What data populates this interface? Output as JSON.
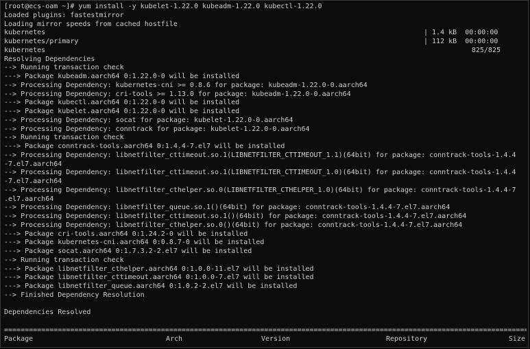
{
  "terminal": {
    "prompt": "[root@ecs-oam ~]# yum install -y kubelet-1.22.0 kubeadm-1.22.0 kubectl-1.22.0",
    "loaded_plugins": "Loaded plugins: fastestmirror",
    "mirror_speeds": "Loading mirror speeds from cached hostfile",
    "repos": [
      {
        "name": "kubernetes",
        "size": "| 1.4 kB  00:00:00",
        "done": ""
      },
      {
        "name": "kubernetes/primary",
        "size": "| 112 kB  00:00:00",
        "done": ""
      },
      {
        "name": "kubernetes",
        "size": "",
        "done": "825/825"
      }
    ],
    "lines": [
      "Resolving Dependencies",
      "--> Running transaction check",
      "---> Package kubeadm.aarch64 0:1.22.0-0 will be installed",
      "--> Processing Dependency: kubernetes-cni >= 0.8.6 for package: kubeadm-1.22.0-0.aarch64",
      "--> Processing Dependency: cri-tools >= 1.13.0 for package: kubeadm-1.22.0-0.aarch64",
      "---> Package kubectl.aarch64 0:1.22.0-0 will be installed",
      "---> Package kubelet.aarch64 0:1.22.0-0 will be installed",
      "--> Processing Dependency: socat for package: kubelet-1.22.0-0.aarch64",
      "--> Processing Dependency: conntrack for package: kubelet-1.22.0-0.aarch64",
      "--> Running transaction check",
      "---> Package conntrack-tools.aarch64 0:1.4.4-7.el7 will be installed",
      "--> Processing Dependency: libnetfilter_cttimeout.so.1(LIBNETFILTER_CTTIMEOUT_1.1)(64bit) for package: conntrack-tools-1.4.4",
      "-7.el7.aarch64",
      "--> Processing Dependency: libnetfilter_cttimeout.so.1(LIBNETFILTER_CTTIMEOUT_1.0)(64bit) for package: conntrack-tools-1.4.4",
      "-7.el7.aarch64",
      "--> Processing Dependency: libnetfilter_cthelper.so.0(LIBNETFILTER_CTHELPER_1.0)(64bit) for package: conntrack-tools-1.4.4-7",
      ".el7.aarch64",
      "--> Processing Dependency: libnetfilter_queue.so.1()(64bit) for package: conntrack-tools-1.4.4-7.el7.aarch64",
      "--> Processing Dependency: libnetfilter_cttimeout.so.1()(64bit) for package: conntrack-tools-1.4.4-7.el7.aarch64",
      "--> Processing Dependency: libnetfilter_cthelper.so.0()(64bit) for package: conntrack-tools-1.4.4-7.el7.aarch64",
      "---> Package cri-tools.aarch64 0:1.24.2-0 will be installed",
      "---> Package kubernetes-cni.aarch64 0:0.8.7-0 will be installed",
      "---> Package socat.aarch64 0:1.7.3.2-2.el7 will be installed",
      "--> Running transaction check",
      "---> Package libnetfilter_cthelper.aarch64 0:1.0.0-11.el7 will be installed",
      "---> Package libnetfilter_cttimeout.aarch64 0:1.0.0-7.el7 will be installed",
      "---> Package libnetfilter_queue.aarch64 0:1.0.2-2.el7 will be installed",
      "--> Finished Dependency Resolution"
    ],
    "resolved": "Dependencies Resolved",
    "rule": "================================================================================================================================",
    "table_header": {
      "package": "Package",
      "arch": "Arch",
      "version": "Version",
      "repository": "Repository",
      "size": "Size"
    },
    "colors": {
      "background": "#0c0c0c",
      "foreground": "#cccccc"
    }
  }
}
